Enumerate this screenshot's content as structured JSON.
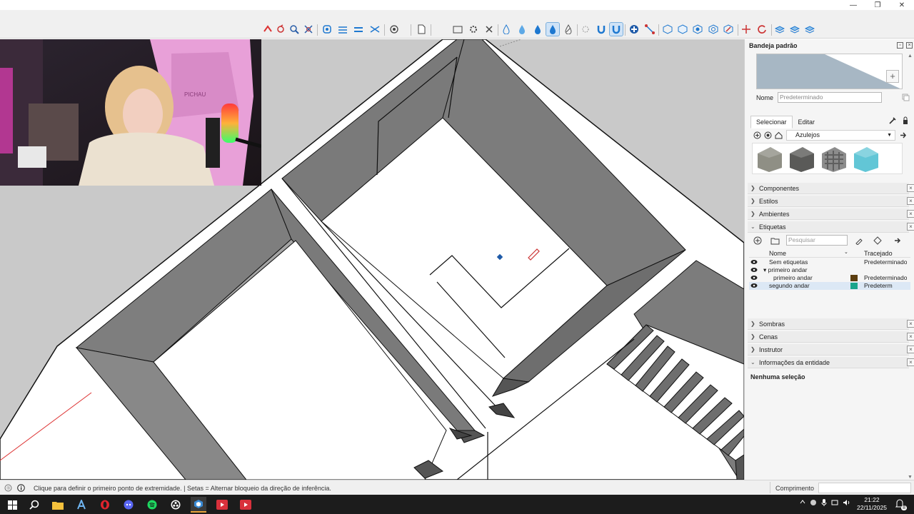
{
  "window": {
    "minimize_glyph": "—",
    "restore_glyph": "❐",
    "close_glyph": "✕"
  },
  "toolbar": {
    "tools": [
      "follow-me-icon",
      "rotate-icon",
      "zoom-icon",
      "zoom-extents-icon",
      "orbit-icon",
      "section-plane-icon",
      "section-fill-icon",
      "section-display-icon",
      "geo-location-icon",
      "new-file-icon",
      "component-icon",
      "settings-gear-icon",
      "delete-icon",
      "paint-bucket-icon",
      "sandbox-drape-icon",
      "sandbox-fill-icon",
      "sandbox-smoove-icon",
      "sandbox-stamp-icon",
      "explode-icon",
      "magnet-icon",
      "magnet-active-icon",
      "add-icon",
      "line-tool-icon",
      "box-iso-icon",
      "box-front-icon",
      "box-top-icon",
      "box-right-icon",
      "box-hidden-icon",
      "move-axes-icon",
      "rotate-refresh-icon",
      "layer-a-icon",
      "layer-b-icon",
      "layer-c-icon"
    ]
  },
  "tray": {
    "title": "Bandeja padrão",
    "name_label": "Nome",
    "name_value": "Predeterminado",
    "materials": {
      "tabs": [
        "Selecionar",
        "Editar"
      ],
      "active_tab": "Selecionar",
      "collection": "Azulejos",
      "swatch_colors": [
        "#8f8f85",
        "#5a5a58",
        "#8c8c8c",
        "#62c6d6"
      ]
    },
    "sections": {
      "componentes": "Componentes",
      "estilos": "Estilos",
      "ambientes": "Ambientes",
      "etiquetas": "Etiquetas",
      "sombras": "Sombras",
      "cenas": "Cenas",
      "instrutor": "Instrutor",
      "entidade": "Informações da entidade"
    },
    "tags": {
      "search_placeholder": "Pesquisar",
      "col_name": "Nome",
      "col_dash": "Tracejado",
      "rows": [
        {
          "name": "Sem etiquetas",
          "dash": "Predeterminado",
          "color": ""
        },
        {
          "name": "▾ primeiro andar",
          "dash": "",
          "color": ""
        },
        {
          "name": "primeiro andar",
          "dash": "Predeterminado",
          "color": "#5b3d0f"
        },
        {
          "name": "segundo andar",
          "dash": "Predeterm",
          "color": "#19a48b"
        }
      ]
    },
    "entity_info": "Nenhuma seleção"
  },
  "status": {
    "hint": "Clique para definir o primeiro ponto de extremidade. | Setas = Alternar bloqueio da direção de inferência.",
    "measure_label": "Comprimento",
    "measure_value": ""
  },
  "taskbar": {
    "time": "21:22",
    "date": "22/11/2025",
    "notification_count": "8",
    "apps": [
      "windows-start-icon",
      "search-icon",
      "file-explorer-icon",
      "autodesk-icon",
      "opera-icon",
      "discord-icon",
      "spotify-icon",
      "obs-icon",
      "sketchup-icon",
      "app-red-1-icon",
      "app-red-2-icon"
    ]
  },
  "colors": {
    "accent": "#1e78d0",
    "wall_dark": "#7a7a7a",
    "wall_light": "#a0a0a0",
    "floor": "#ffffff",
    "background": "#c9c9c9"
  }
}
